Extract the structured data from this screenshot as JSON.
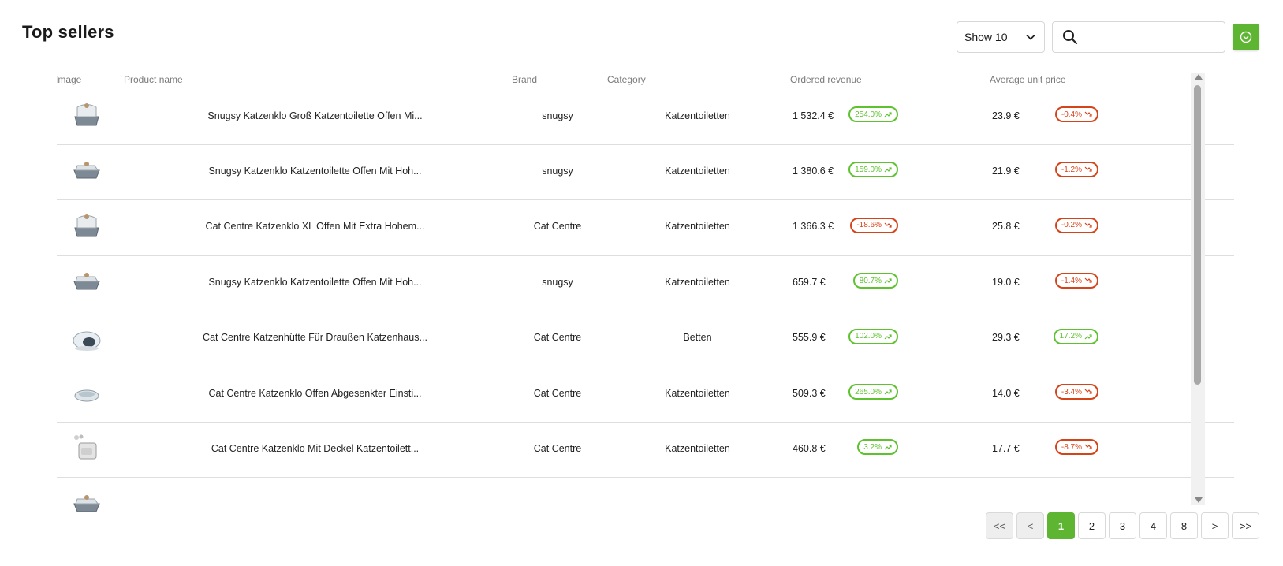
{
  "title": "Top sellers",
  "toolbar": {
    "show_label": "Show 10",
    "search_placeholder": "",
    "accent": "#5db531"
  },
  "columns": {
    "image": "Image",
    "product": "Product name",
    "brand": "Brand",
    "category": "Category",
    "revenue": "Ordered revenue",
    "price": "Average unit price"
  },
  "rows": [
    {
      "product": "Snugsy Katzenklo Groß Katzentoilette Offen Mi...",
      "brand": "snugsy",
      "category": "Katzentoiletten",
      "revenue": "1 532.4 €",
      "revenue_change": "254.0%",
      "revenue_trend": "up",
      "price": "23.9 €",
      "price_change": "-0.4%",
      "price_trend": "down",
      "image_icon": "litter-box-hooded-icon"
    },
    {
      "product": "Snugsy Katzenklo Katzentoilette Offen Mit Hoh...",
      "brand": "snugsy",
      "category": "Katzentoiletten",
      "revenue": "1 380.6 €",
      "revenue_change": "159.0%",
      "revenue_trend": "up",
      "price": "21.9 €",
      "price_change": "-1.2%",
      "price_trend": "down",
      "image_icon": "litter-box-open-icon"
    },
    {
      "product": "Cat Centre Katzenklo XL Offen Mit Extra Hohem...",
      "brand": "Cat Centre",
      "category": "Katzentoiletten",
      "revenue": "1 366.3 €",
      "revenue_change": "-18.6%",
      "revenue_trend": "down",
      "price": "25.8 €",
      "price_change": "-0.2%",
      "price_trend": "down",
      "image_icon": "litter-box-hooded-icon"
    },
    {
      "product": "Snugsy Katzenklo Katzentoilette Offen Mit Hoh...",
      "brand": "snugsy",
      "category": "Katzentoiletten",
      "revenue": "659.7 €",
      "revenue_change": "80.7%",
      "revenue_trend": "up",
      "price": "19.0 €",
      "price_change": "-1.4%",
      "price_trend": "down",
      "image_icon": "litter-box-open-icon"
    },
    {
      "product": "Cat Centre Katzenhütte Für Draußen Katzenhaus...",
      "brand": "Cat Centre",
      "category": "Betten",
      "revenue": "555.9 €",
      "revenue_change": "102.0%",
      "revenue_trend": "up",
      "price": "29.3 €",
      "price_change": "17.2%",
      "price_trend": "up",
      "image_icon": "cat-igloo-icon"
    },
    {
      "product": "Cat Centre Katzenklo Offen Abgesenkter Einsti...",
      "brand": "Cat Centre",
      "category": "Katzentoiletten",
      "revenue": "509.3 €",
      "revenue_change": "265.0%",
      "revenue_trend": "up",
      "price": "14.0 €",
      "price_change": "-3.4%",
      "price_trend": "down",
      "image_icon": "litter-tray-icon"
    },
    {
      "product": "Cat Centre Katzenklo Mit Deckel Katzentoilett...",
      "brand": "Cat Centre",
      "category": "Katzentoiletten",
      "revenue": "460.8 €",
      "revenue_change": "3.2%",
      "revenue_trend": "up",
      "price": "17.7 €",
      "price_change": "-8.7%",
      "price_trend": "down",
      "image_icon": "litter-box-lid-icon"
    },
    {
      "product": "",
      "brand": "",
      "category": "",
      "revenue": "",
      "revenue_change": "",
      "revenue_trend": "down",
      "price": "",
      "price_change": "",
      "price_trend": "down",
      "image_icon": "litter-box-open-icon"
    }
  ],
  "pagination": {
    "first": "<<",
    "prev": "<",
    "pages": [
      "1",
      "2",
      "3",
      "4",
      "8"
    ],
    "next": ">",
    "last": ">>",
    "current": "1"
  },
  "colors": {
    "up": "#5ec22f",
    "down": "#d54419",
    "accent": "#5db531"
  }
}
